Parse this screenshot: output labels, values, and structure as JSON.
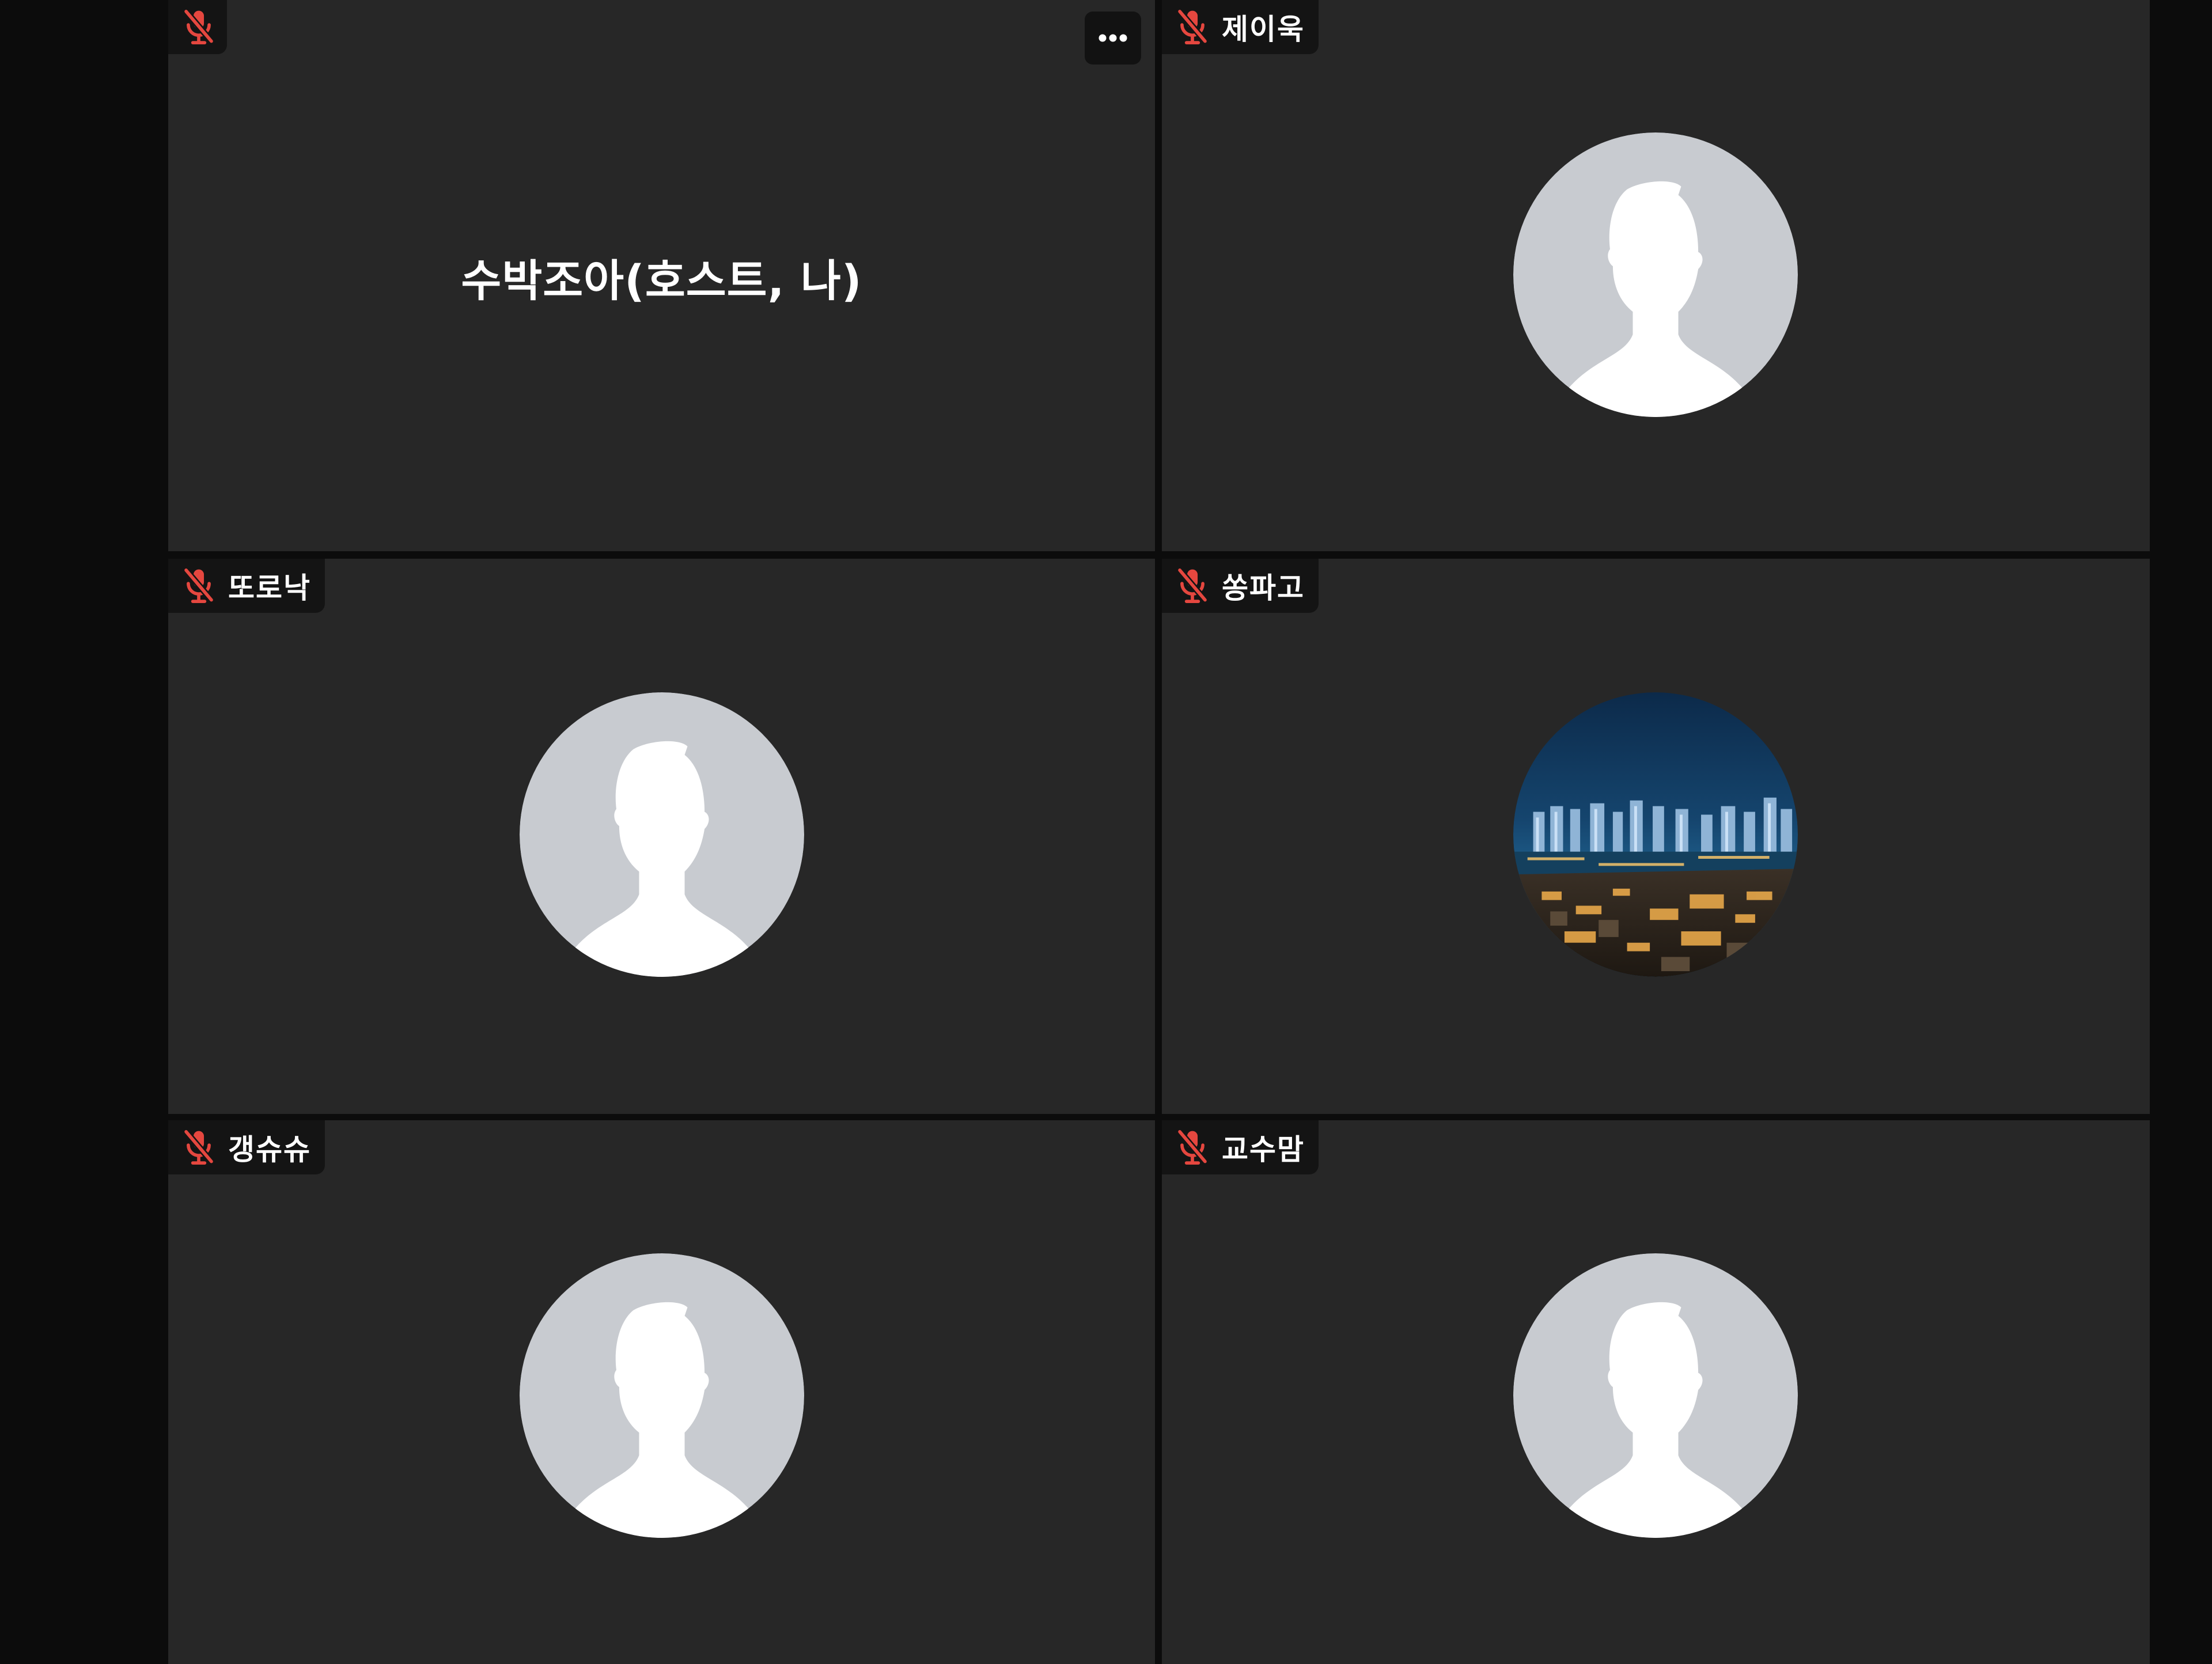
{
  "meeting": {
    "participants": [
      {
        "name": "수박조아(호스트, 나)",
        "tag_label": "",
        "mic": "muted",
        "avatar": "none",
        "has_more_button": true
      },
      {
        "name": "제이욱",
        "tag_label": "제이욱",
        "mic": "muted",
        "avatar": "default-person"
      },
      {
        "name": "또로낙",
        "tag_label": "또로낙",
        "mic": "muted",
        "avatar": "default-person"
      },
      {
        "name": "쏭파고",
        "tag_label": "쏭파고",
        "mic": "muted",
        "avatar": "city-night-photo"
      },
      {
        "name": "갱슈슈",
        "tag_label": "갱슈슈",
        "mic": "muted",
        "avatar": "default-person"
      },
      {
        "name": "교수맘",
        "tag_label": "교수맘",
        "mic": "muted",
        "avatar": "default-person"
      }
    ]
  },
  "icons": {
    "mic_muted": "mic-muted-icon",
    "more": "more-options-icon",
    "avatar_default": "default-avatar-icon"
  },
  "colors": {
    "page_background": "#0c0c0c",
    "tile_background": "#272727",
    "name_tag_background": "#141414",
    "mic_muted_red": "#e5473f",
    "avatar_circle": "#c8cbd0",
    "avatar_silhouette": "#ffffff",
    "text": "#ffffff"
  }
}
